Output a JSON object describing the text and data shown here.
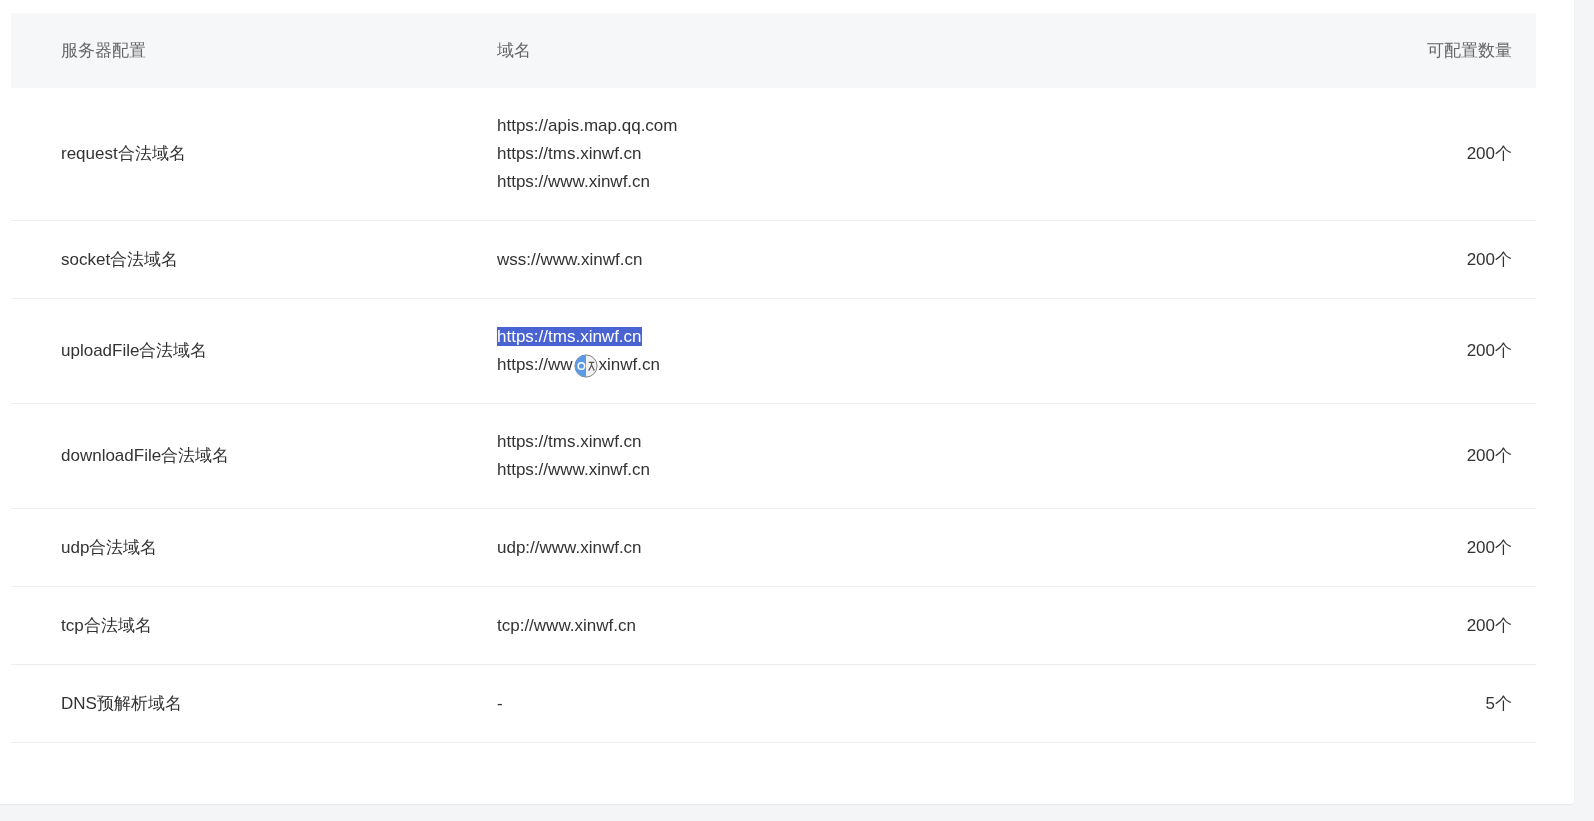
{
  "table": {
    "columns": [
      "服务器配置",
      "域名",
      "可配置数量"
    ],
    "rows": [
      {
        "config": "request合法域名",
        "domains": [
          {
            "text": "https://apis.map.qq.com",
            "selected": false
          },
          {
            "text": "https://tms.xinwf.cn",
            "selected": false
          },
          {
            "text": "https://www.xinwf.cn",
            "selected": false
          }
        ],
        "count": "200个"
      },
      {
        "config": "socket合法域名",
        "domains": [
          {
            "text": "wss://www.xinwf.cn",
            "selected": false
          }
        ],
        "count": "200个"
      },
      {
        "config": "uploadFile合法域名",
        "domains": [
          {
            "text": "https://tms.xinwf.cn",
            "selected": true
          },
          {
            "text": "https://ww",
            "text_after": "xinwf.cn",
            "selected": false,
            "translate_popup": true
          }
        ],
        "count": "200个"
      },
      {
        "config": "downloadFile合法域名",
        "domains": [
          {
            "text": "https://tms.xinwf.cn",
            "selected": false
          },
          {
            "text": "https://www.xinwf.cn",
            "selected": false
          }
        ],
        "count": "200个"
      },
      {
        "config": "udp合法域名",
        "domains": [
          {
            "text": "udp://www.xinwf.cn",
            "selected": false
          }
        ],
        "count": "200个"
      },
      {
        "config": "tcp合法域名",
        "domains": [
          {
            "text": "tcp://www.xinwf.cn",
            "selected": false
          }
        ],
        "count": "200个"
      },
      {
        "config": "DNS预解析域名",
        "domains": [
          {
            "text": "-",
            "selected": false
          }
        ],
        "count": "5个"
      }
    ]
  }
}
